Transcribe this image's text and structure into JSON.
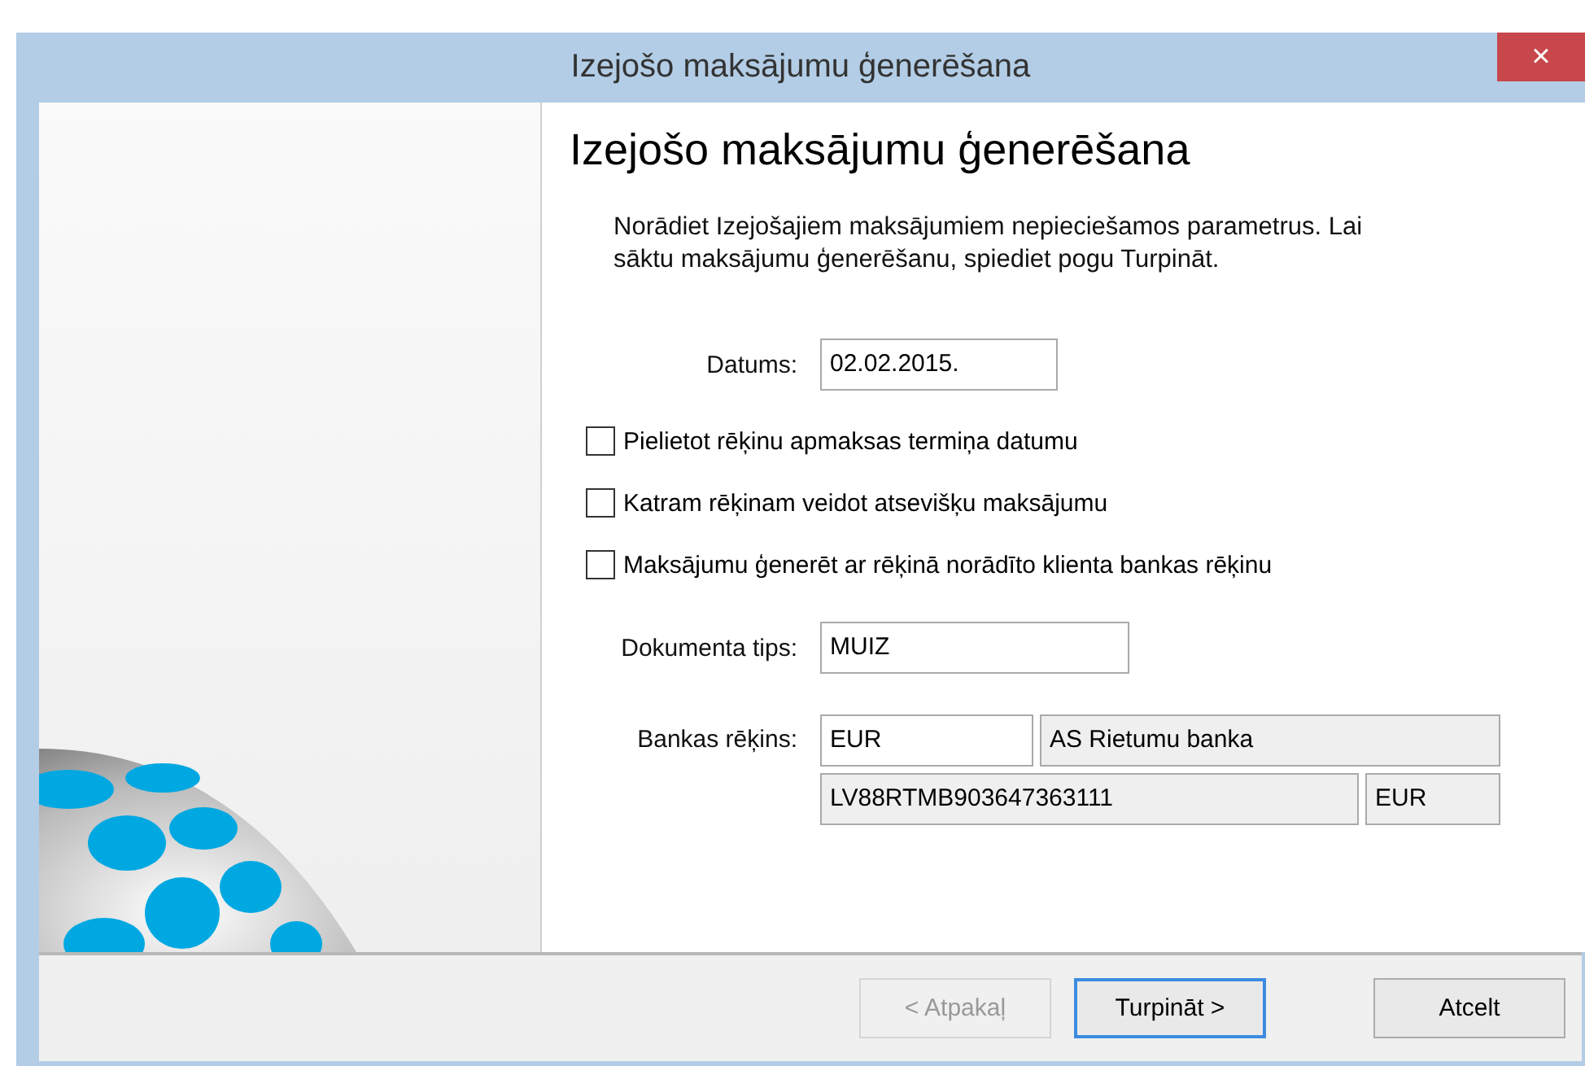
{
  "window": {
    "title": "Izejošo maksājumu ģenerēšana",
    "close": "×"
  },
  "heading": "Izejošo maksājumu ģenerēšana",
  "description": "Norādiet Izejošajiem maksājumiem nepieciešamos parametrus. Lai sāktu maksājumu ģenerēšanu, spiediet pogu Turpināt.",
  "date": {
    "label": "Datums:",
    "value": "02.02.2015."
  },
  "options": [
    {
      "label": "Pielietot rēķinu apmaksas termiņa datumu",
      "checked": false
    },
    {
      "label": "Katram rēķinam veidot atsevišķu maksājumu",
      "checked": false
    },
    {
      "label": "Maksājumu ģenerēt ar rēķinā norādīto klienta bankas rēķinu",
      "checked": false
    }
  ],
  "document_type": {
    "label": "Dokumenta tips:",
    "value": "MUIZ"
  },
  "bank_account": {
    "label": "Bankas rēķins:",
    "fields": [
      {
        "value": "EUR",
        "readonly": false
      },
      {
        "value": "AS Rietumu banka",
        "readonly": true
      },
      {
        "value": "LV88RTMB903647363111",
        "readonly": true
      },
      {
        "value": "EUR",
        "readonly": true
      }
    ]
  },
  "buttons": [
    {
      "label": "< Atpakaļ",
      "disabled": true,
      "default": false
    },
    {
      "label": "Turpināt >",
      "disabled": false,
      "default": true
    },
    {
      "label": "Atcelt",
      "disabled": false,
      "default": false
    }
  ]
}
